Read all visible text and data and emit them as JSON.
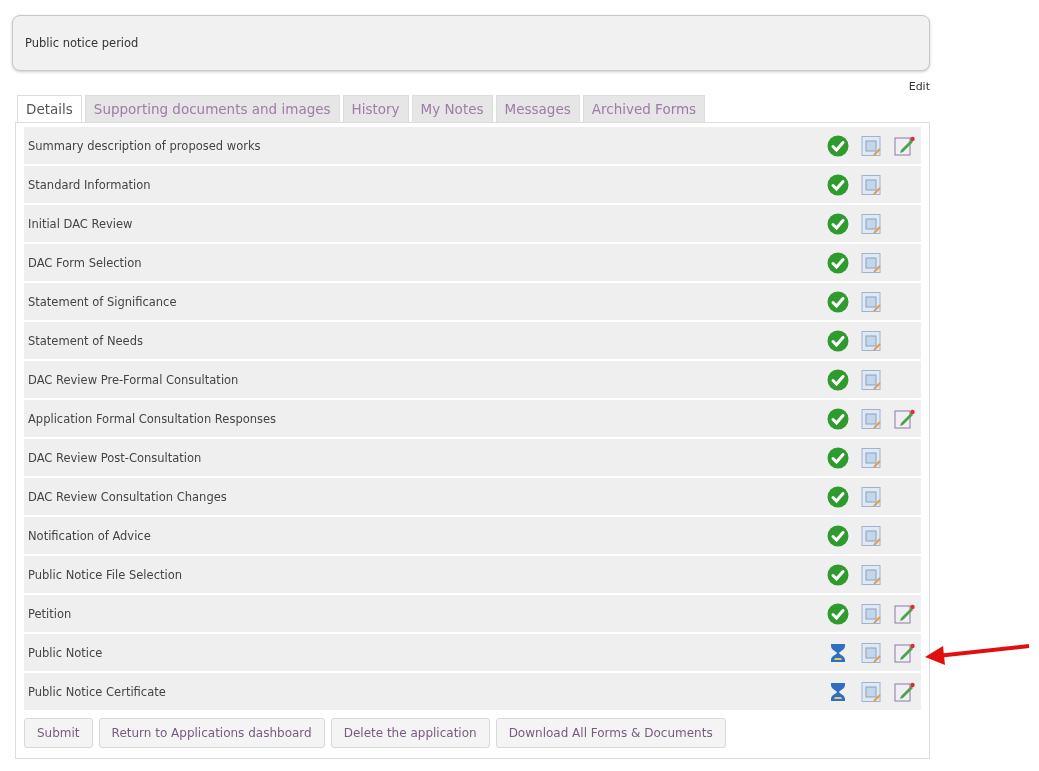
{
  "notice_panel": {
    "text": "Public notice period"
  },
  "edit_link": "Edit",
  "tabs": [
    {
      "label": "Details",
      "selected": true
    },
    {
      "label": "Supporting documents and images",
      "selected": false
    },
    {
      "label": "History",
      "selected": false
    },
    {
      "label": "My Notes",
      "selected": false
    },
    {
      "label": "Messages",
      "selected": false
    },
    {
      "label": "Archived Forms",
      "selected": false
    }
  ],
  "rows": [
    {
      "name": "Summary description of proposed works",
      "complete": true,
      "editable": true
    },
    {
      "name": "Standard Information",
      "complete": true,
      "editable": false
    },
    {
      "name": "Initial DAC Review",
      "complete": true,
      "editable": false
    },
    {
      "name": "DAC Form Selection",
      "complete": true,
      "editable": false
    },
    {
      "name": "Statement of Significance",
      "complete": true,
      "editable": false
    },
    {
      "name": "Statement of Needs",
      "complete": true,
      "editable": false
    },
    {
      "name": "DAC Review Pre-Formal Consultation",
      "complete": true,
      "editable": false
    },
    {
      "name": "Application Formal Consultation Responses",
      "complete": true,
      "editable": true
    },
    {
      "name": "DAC Review Post-Consultation",
      "complete": true,
      "editable": false
    },
    {
      "name": "DAC Review Consultation Changes",
      "complete": true,
      "editable": false
    },
    {
      "name": "Notification of Advice",
      "complete": true,
      "editable": false
    },
    {
      "name": "Public Notice File Selection",
      "complete": true,
      "editable": false
    },
    {
      "name": "Petition",
      "complete": true,
      "editable": true
    },
    {
      "name": "Public Notice",
      "complete": false,
      "editable": true,
      "highlighted": true
    },
    {
      "name": "Public Notice Certificate",
      "complete": false,
      "editable": true
    }
  ],
  "buttons": [
    "Submit",
    "Return to Applications dashboard",
    "Delete the application",
    "Download All Forms & Documents"
  ]
}
